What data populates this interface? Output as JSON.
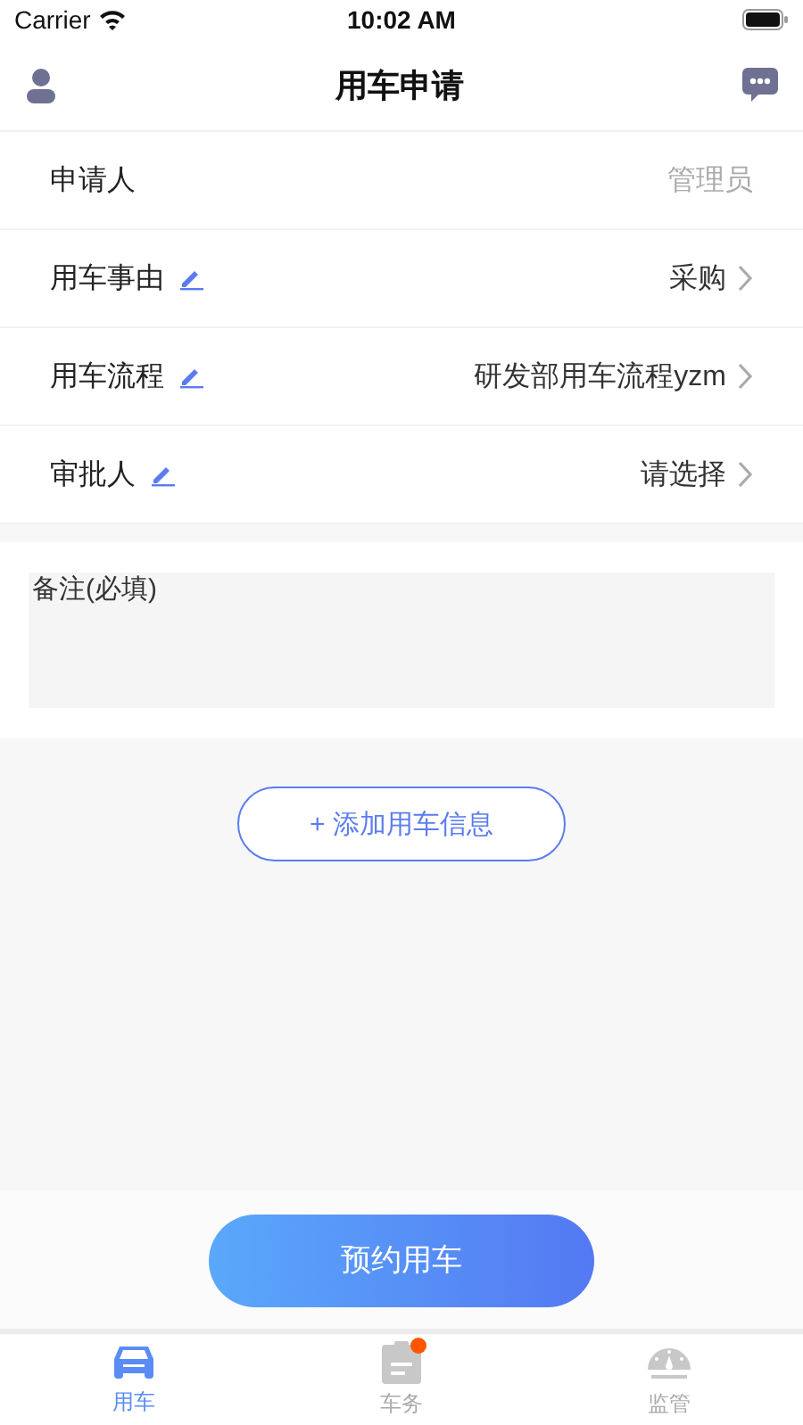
{
  "status_bar": {
    "carrier": "Carrier",
    "time": "10:02 AM"
  },
  "nav": {
    "title": "用车申请"
  },
  "rows": [
    {
      "label": "申请人",
      "value": "管理员",
      "kind": "static",
      "editable": false
    },
    {
      "label": "用车事由",
      "value": "采购",
      "kind": "select",
      "editable": true
    },
    {
      "label": "用车流程",
      "value": "研发部用车流程yzm",
      "kind": "select",
      "editable": true
    },
    {
      "label": "审批人",
      "value": "请选择",
      "kind": "select",
      "editable": true
    }
  ],
  "remark": {
    "placeholder": "备注(必填)"
  },
  "add_button": "+ 添加用车信息",
  "submit_button": "预约用车",
  "tabs": [
    {
      "label": "用车",
      "selected": true,
      "kind": "car",
      "badge": false
    },
    {
      "label": "车务",
      "selected": false,
      "kind": "clipboard",
      "badge": true
    },
    {
      "label": "监管",
      "selected": false,
      "kind": "gauge",
      "badge": false
    }
  ]
}
